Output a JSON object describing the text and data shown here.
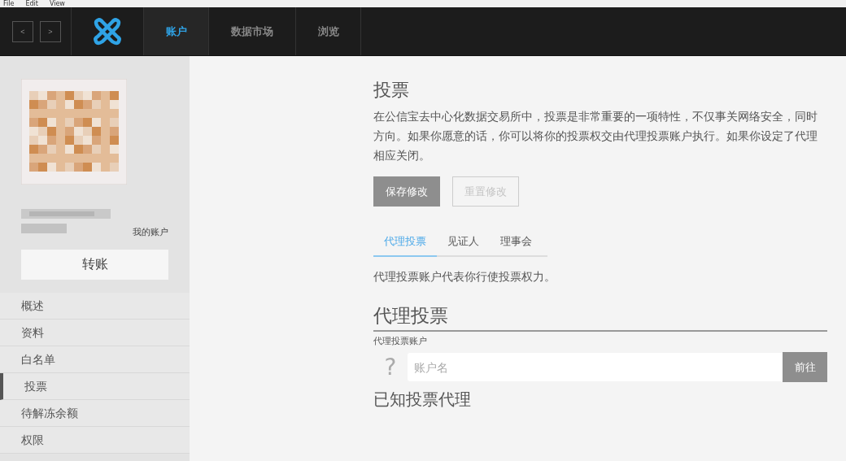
{
  "menu_bar": [
    "File",
    "Edit",
    "View"
  ],
  "nav": {
    "back": "<",
    "forward": ">",
    "tabs": [
      {
        "label": "账户",
        "selected": true
      },
      {
        "label": "数据市场",
        "selected": false
      },
      {
        "label": "浏览",
        "selected": false
      }
    ]
  },
  "sidebar": {
    "account_label": "我的账户",
    "transfer_button": "转账",
    "items": [
      {
        "label": "概述",
        "selected": false
      },
      {
        "label": "资料",
        "selected": false
      },
      {
        "label": "白名单",
        "selected": false
      },
      {
        "label": "投票",
        "selected": true
      },
      {
        "label": "待解冻余额",
        "selected": false
      },
      {
        "label": "权限",
        "selected": false
      }
    ]
  },
  "main": {
    "title": "投票",
    "intro_lines": [
      "在公信宝去中心化数据交易所中，投票是非常重要的一项特性，不仅事关网络安全，同时",
      "方向。如果你愿意的话，你可以将你的投票权交由代理投票账户执行。如果你设定了代理",
      "相应关闭。"
    ],
    "save_button": "保存修改",
    "reset_button": {
      "label": "重置修改",
      "disabled": true
    },
    "tabs": [
      {
        "label": "代理投票",
        "selected": true
      },
      {
        "label": "见证人",
        "selected": false
      },
      {
        "label": "理事会",
        "selected": false
      }
    ],
    "tab_description": "代理投票账户代表你行使投票权力。",
    "proxy_heading": "代理投票",
    "field_label": "代理投票账户",
    "unknown_mark": "?",
    "input_placeholder": "账户名",
    "go_button": "前往",
    "known_heading": "已知投票代理"
  }
}
